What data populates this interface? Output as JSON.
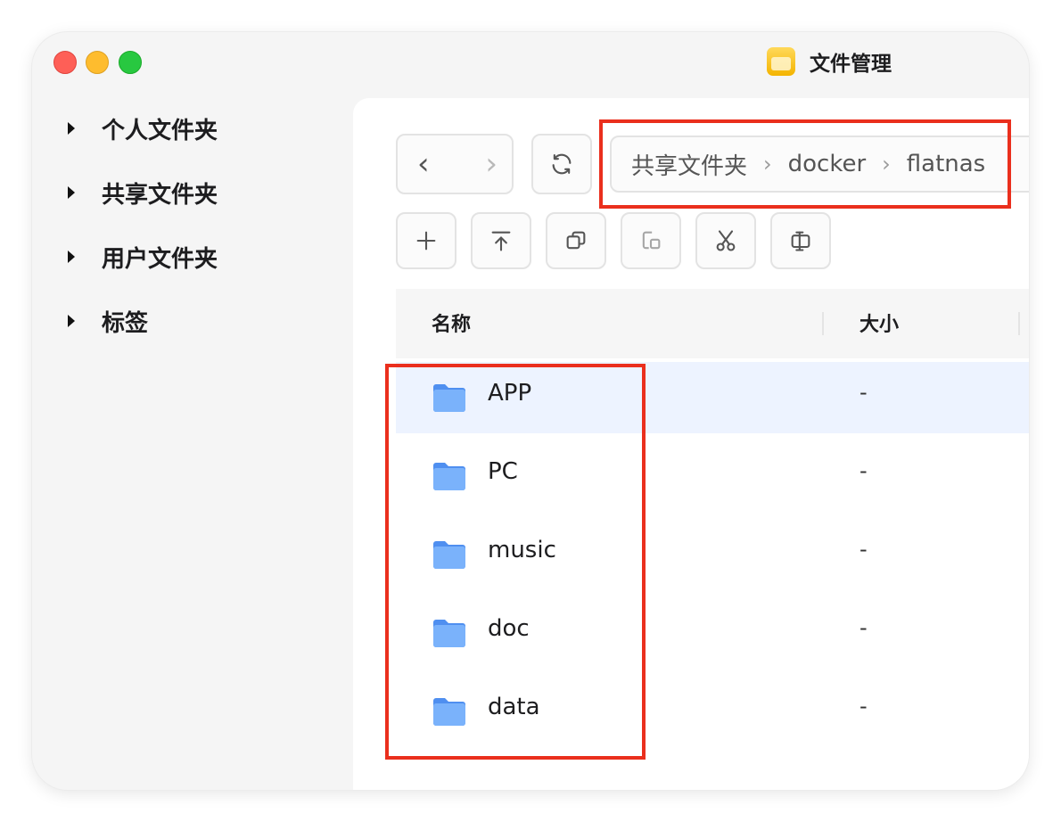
{
  "window": {
    "title": "文件管理",
    "icon": "folder-app-icon"
  },
  "sidebar": {
    "items": [
      {
        "label": "个人文件夹"
      },
      {
        "label": "共享文件夹"
      },
      {
        "label": "用户文件夹"
      },
      {
        "label": "标签"
      }
    ]
  },
  "navigation": {
    "back_icon": "chevron-left-icon",
    "forward_icon": "chevron-right-icon",
    "refresh_icon": "refresh-icon"
  },
  "breadcrumb": {
    "items": [
      "共享文件夹",
      "docker",
      "flatnas"
    ],
    "separator": "›"
  },
  "toolbar": {
    "icons": [
      "plus-icon",
      "upload-icon",
      "copy-icon",
      "paste-icon",
      "scissors-icon",
      "rename-icon"
    ]
  },
  "table": {
    "columns": [
      "名称",
      "大小"
    ],
    "rows": [
      {
        "name": "APP",
        "size": "-",
        "selected": true
      },
      {
        "name": "PC",
        "size": "-"
      },
      {
        "name": "music",
        "size": "-"
      },
      {
        "name": "doc",
        "size": "-"
      },
      {
        "name": "data",
        "size": "-"
      }
    ]
  },
  "colors": {
    "highlight": "#ea2f1d",
    "selection": "#edf3ff",
    "folder": "#5b9cf5"
  }
}
